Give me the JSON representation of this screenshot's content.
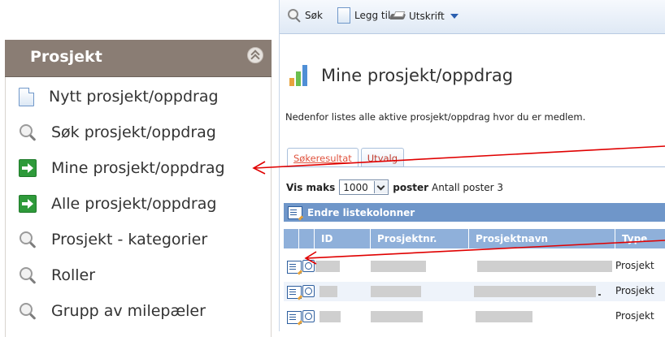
{
  "sidebar": {
    "title": "Prosjekt",
    "items": [
      {
        "label": "Nytt prosjekt/oppdrag",
        "icon": "new-document-icon"
      },
      {
        "label": "Søk prosjekt/oppdrag",
        "icon": "search-icon"
      },
      {
        "label": "Mine prosjekt/oppdrag",
        "icon": "go-arrow-icon"
      },
      {
        "label": "Alle prosjekt/oppdrag",
        "icon": "go-arrow-icon"
      },
      {
        "label": "Prosjekt - kategorier",
        "icon": "search-icon"
      },
      {
        "label": "Roller",
        "icon": "search-icon"
      },
      {
        "label": "Grupp av milepæler",
        "icon": "search-icon"
      }
    ]
  },
  "toolbar": {
    "search_label": "Søk",
    "add_label": "Legg til",
    "print_label": "Utskrift"
  },
  "main": {
    "title": "Mine prosjekt/oppdrag",
    "description": "Nedenfor listes alle aktive prosjekt/oppdrag hvor du er medlem.",
    "tabs": [
      {
        "label": "Søkeresultat",
        "active": true
      },
      {
        "label": "Utvalg",
        "active": false
      }
    ],
    "vis_maks_label": "Vis maks",
    "vis_maks_value": "1000",
    "poster_label": "poster",
    "count_text": "Antall poster 3",
    "list_columns_label": "Endre listekolonner",
    "columns": [
      "ID",
      "Prosjektnr.",
      "Prosjektnavn",
      "Type"
    ],
    "rows": [
      {
        "type": "Prosjekt"
      },
      {
        "type": "Prosjekt"
      },
      {
        "type": "Prosjekt"
      }
    ]
  },
  "colors": {
    "sidebar_header": "#8a7d74",
    "accent_blue": "#6f96c9",
    "annotation_red": "#e00000"
  }
}
